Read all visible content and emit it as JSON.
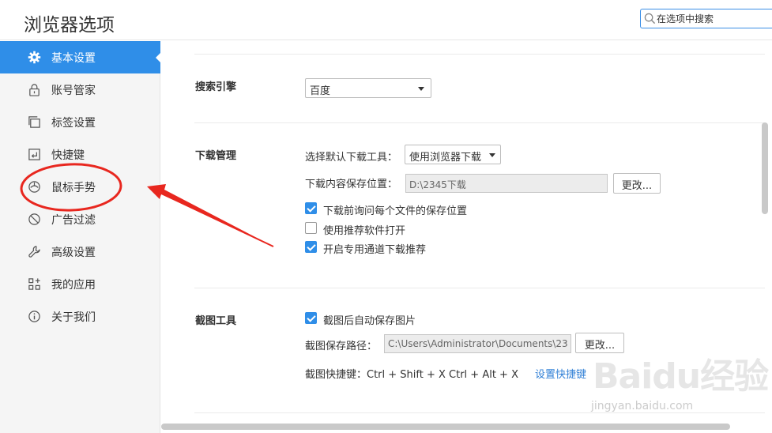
{
  "window": {
    "title": "浏览器选项"
  },
  "search": {
    "placeholder": "在选项中搜索"
  },
  "sidebar": {
    "items": [
      {
        "label": "基本设置",
        "icon": "gear-icon",
        "active": true
      },
      {
        "label": "账号管家",
        "icon": "lock-icon"
      },
      {
        "label": "标签设置",
        "icon": "tabs-icon"
      },
      {
        "label": "快捷键",
        "icon": "keyboard-shortcut-icon"
      },
      {
        "label": "鼠标手势",
        "icon": "mouse-icon"
      },
      {
        "label": "广告过滤",
        "icon": "block-icon"
      },
      {
        "label": "高级设置",
        "icon": "wrench-icon"
      },
      {
        "label": "我的应用",
        "icon": "apps-grid-icon"
      },
      {
        "label": "关于我们",
        "icon": "info-icon"
      }
    ]
  },
  "search_engine": {
    "label": "搜索引擎",
    "selected": "百度"
  },
  "download": {
    "label": "下载管理",
    "tool_label": "选择默认下载工具：",
    "tool_selected": "使用浏览器下载",
    "path_label": "下载内容保存位置：",
    "path_value": "D:\\2345下载",
    "change_button": "更改...",
    "options": [
      {
        "label": "下载前询问每个文件的保存位置",
        "checked": true
      },
      {
        "label": "使用推荐软件打开",
        "checked": false
      },
      {
        "label": "开启专用通道下载推荐",
        "checked": true
      }
    ]
  },
  "screenshot": {
    "label": "截图工具",
    "auto_save": {
      "label": "截图后自动保存图片",
      "checked": true
    },
    "path_label": "截图保存路径：",
    "path_value": "C:\\Users\\Administrator\\Documents\\23",
    "change_button": "更改...",
    "shortcut_text": "截图快捷键：Ctrl + Shift + X  Ctrl + Alt + X",
    "shortcut_link": "设置快捷键"
  },
  "watermark": {
    "logo": "Baidu经验",
    "url": "jingyan.baidu.com"
  },
  "colors": {
    "accent": "#2f8ee8",
    "annotation": "#e8271f"
  }
}
